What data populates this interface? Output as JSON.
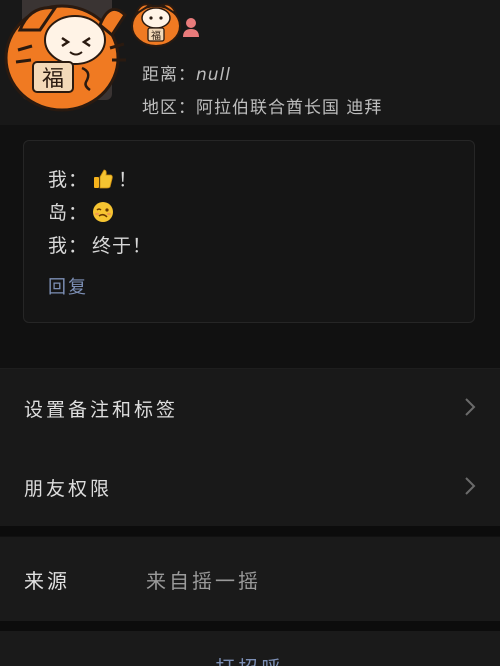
{
  "profile": {
    "distance_label": "距离：",
    "distance_value": "null",
    "region_label": "地区：",
    "region_value": "阿拉伯联合酋长国 迪拜",
    "avatar_badge_text": "福",
    "small_sticker_badge_text": "福"
  },
  "moment": {
    "line1_speaker": "我：",
    "line1_emoji": "thumbs-up",
    "line1_text": "！",
    "line2_speaker": "岛：",
    "line2_emoji": "woozy-face",
    "line3_speaker": "我：",
    "line3_text": "终于！",
    "reply_label": "回复"
  },
  "settings": {
    "remarks_label": "设置备注和标签",
    "permission_label": "朋友权限"
  },
  "source": {
    "label": "来源",
    "value": "来自摇一摇"
  },
  "bottom_action": {
    "label": "打招呼"
  },
  "colors": {
    "background": "#111111",
    "link": "#7c8fb5",
    "tiger_orange": "#f07a22"
  }
}
